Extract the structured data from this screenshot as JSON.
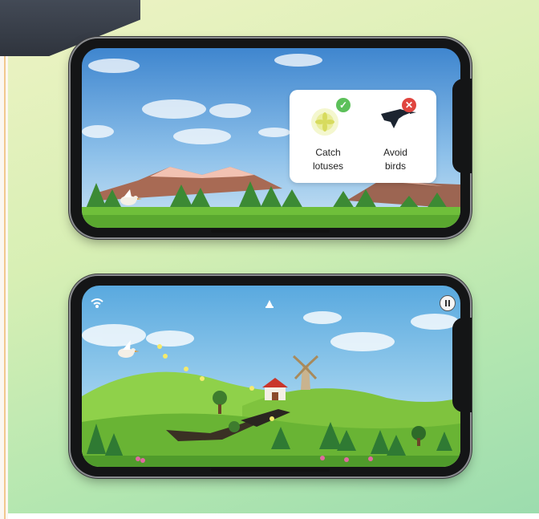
{
  "tutorial": {
    "catch_label": "Catch\nlotuses",
    "avoid_label": "Avoid\nbirds",
    "catch_icon": "lotus-icon",
    "avoid_icon": "crow-icon",
    "check_icon": "checkmark-icon",
    "cross_icon": "cross-icon"
  },
  "gameplay": {
    "pause_icon": "pause-icon",
    "wifi_icon": "wifi-icon",
    "counter_icon": "lotus-counter-icon"
  },
  "colors": {
    "check": "#5cc05a",
    "cross": "#e0453f",
    "sky": "#7cb8e8",
    "grass": "#6fbf3a"
  }
}
